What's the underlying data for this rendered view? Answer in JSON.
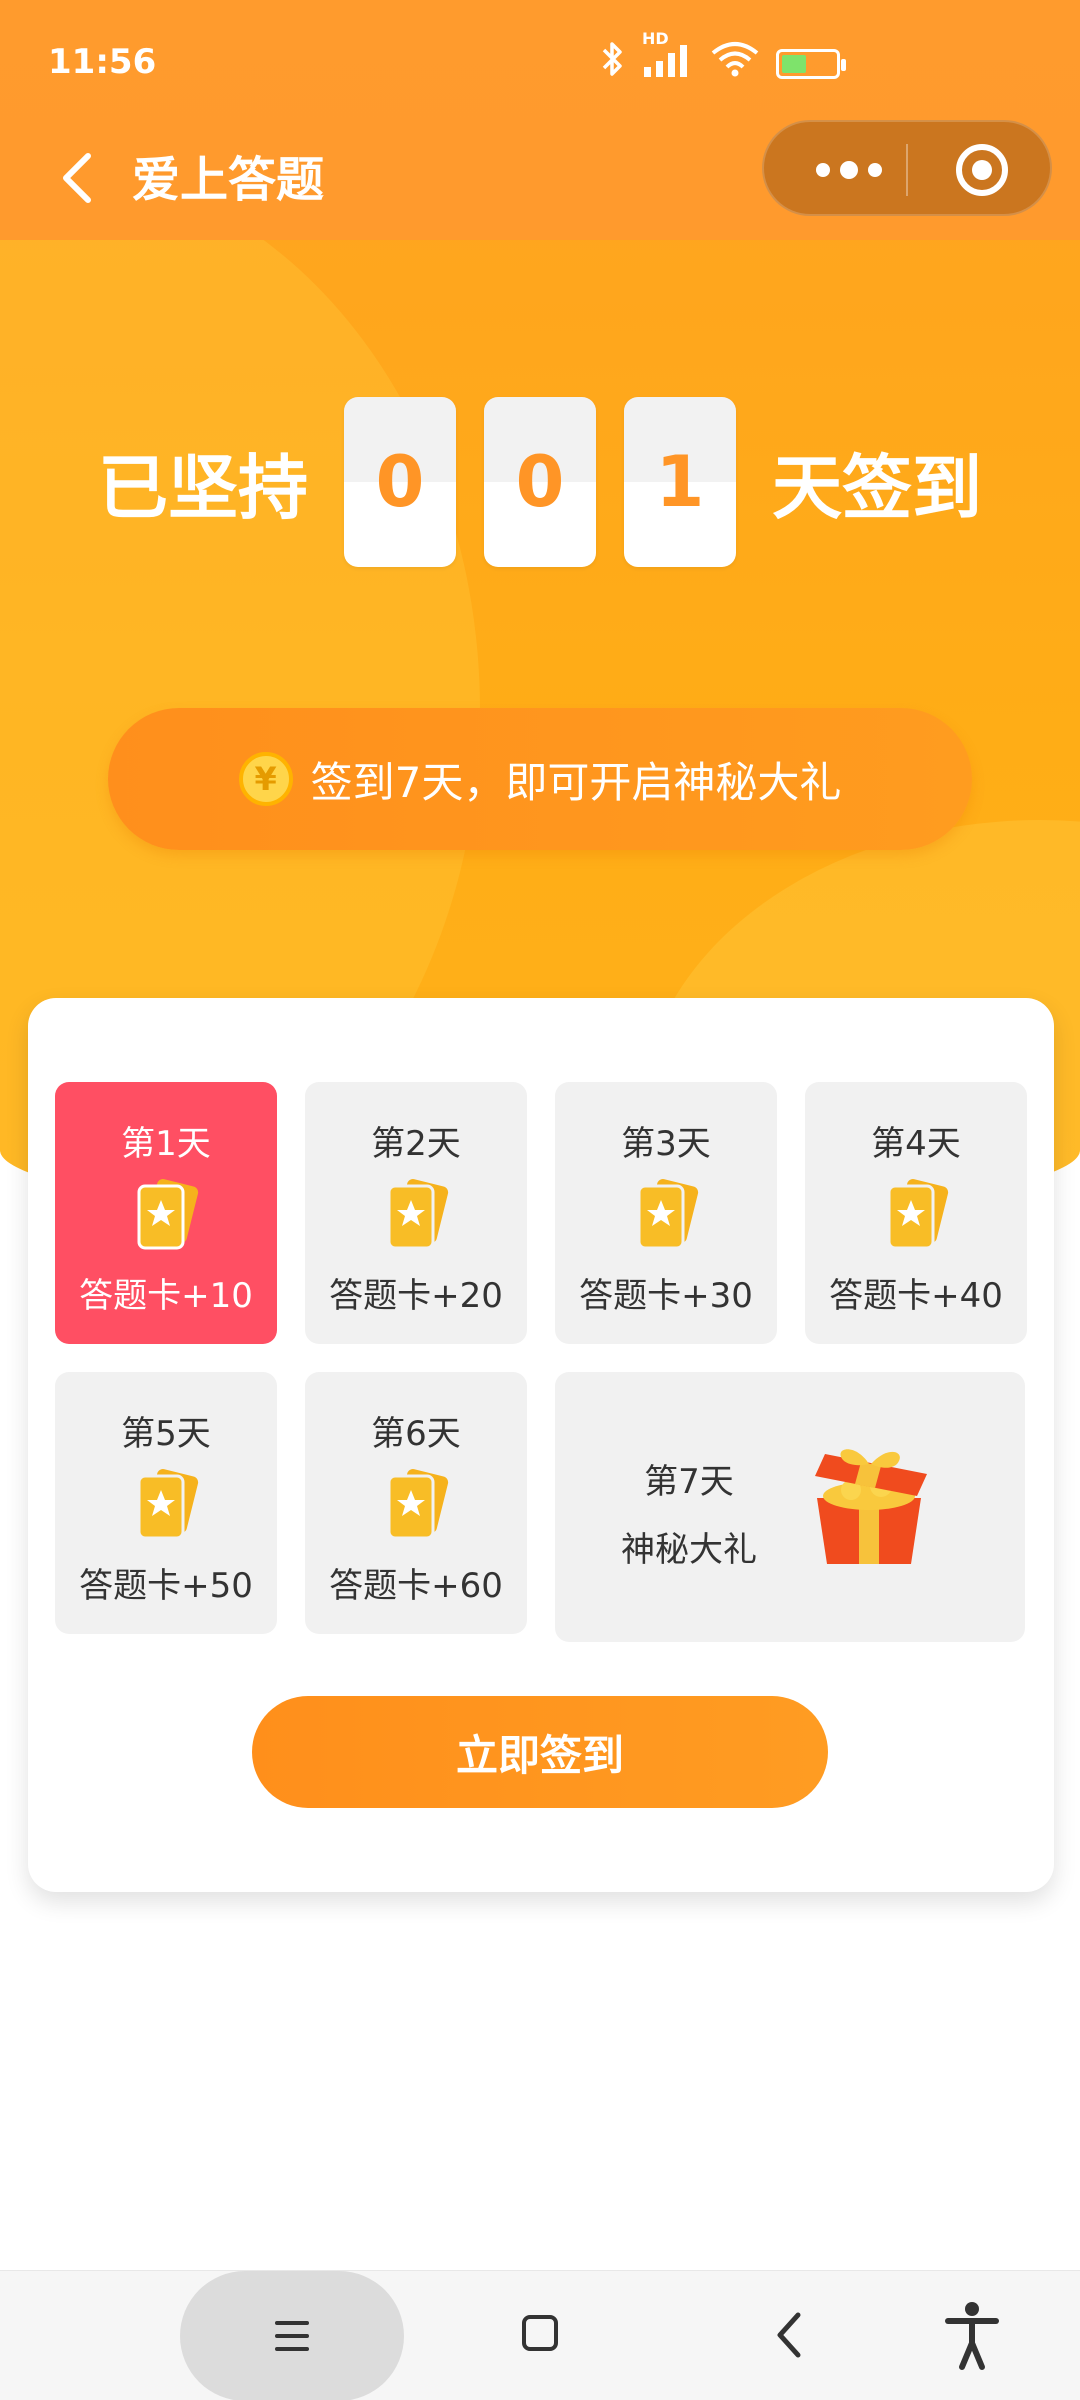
{
  "status_bar": {
    "time": "11:56",
    "icons": [
      "bluetooth-icon",
      "signal-icon",
      "wifi-icon",
      "battery-charging-icon"
    ],
    "network_label": "HD"
  },
  "nav": {
    "title": "爱上答题",
    "back_icon": "chevron-left-icon",
    "menu_icon": "more-dots-icon",
    "close_icon": "target-icon"
  },
  "counter": {
    "prefix": "已坚持",
    "digits": [
      "0",
      "0",
      "1"
    ],
    "suffix": "天签到"
  },
  "tip": {
    "coin_symbol": "¥",
    "text": "签到7天，即可开启神秘大礼"
  },
  "days": [
    {
      "label": "第1天",
      "reward": "答题卡+10",
      "active": true
    },
    {
      "label": "第2天",
      "reward": "答题卡+20",
      "active": false
    },
    {
      "label": "第3天",
      "reward": "答题卡+30",
      "active": false
    },
    {
      "label": "第4天",
      "reward": "答题卡+40",
      "active": false
    },
    {
      "label": "第5天",
      "reward": "答题卡+50",
      "active": false
    },
    {
      "label": "第6天",
      "reward": "答题卡+60",
      "active": false
    },
    {
      "label": "第7天",
      "reward": "神秘大礼",
      "active": false
    }
  ],
  "checkin_button": "立即签到",
  "colors": {
    "orange": "#ff9a2a",
    "active_red": "#ff4f63",
    "tile_gray": "#f1f1f1",
    "card_yellow": "#f6b21c"
  }
}
